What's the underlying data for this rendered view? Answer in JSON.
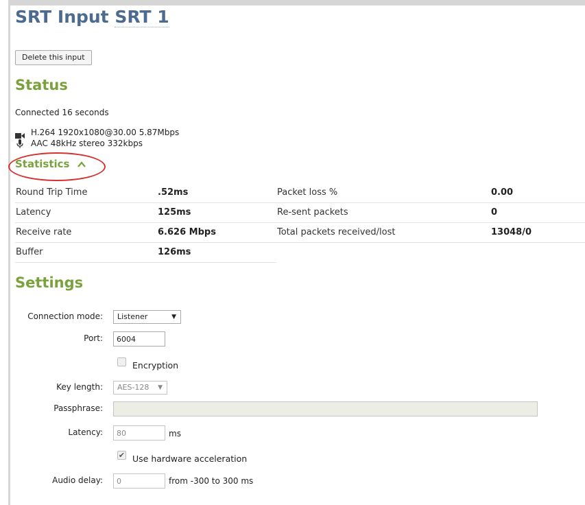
{
  "header": {
    "title_prefix": "SRT Input",
    "title_name": "SRT 1"
  },
  "actions": {
    "delete_label": "Delete this input"
  },
  "status": {
    "heading": "Status",
    "connected_text": "Connected 16 seconds",
    "video_info": "H.264 1920x1080@30.00 5.87Mbps",
    "audio_info": "AAC 48kHz stereo 332kbps",
    "icons": {
      "video": "video-camera-icon",
      "audio": "microphone-icon"
    }
  },
  "statistics": {
    "toggle_label": "Statistics",
    "toggle_icon": "^",
    "left": [
      {
        "label": "Round Trip Time",
        "value": ".52ms"
      },
      {
        "label": "Latency",
        "value": "125ms"
      },
      {
        "label": "Receive rate",
        "value": "6.626 Mbps"
      },
      {
        "label": "Buffer",
        "value": "126ms"
      }
    ],
    "right": [
      {
        "label": "Packet loss %",
        "value": "0.00"
      },
      {
        "label": "Re-sent packets",
        "value": "0"
      },
      {
        "label": "Total packets received/lost",
        "value": "13048/0"
      }
    ]
  },
  "settings": {
    "heading": "Settings",
    "connection_mode": {
      "label": "Connection mode:",
      "value": "Listener"
    },
    "port": {
      "label": "Port:",
      "value": "6004"
    },
    "encryption": {
      "label": "Encryption",
      "checked": false
    },
    "key_length": {
      "label": "Key length:",
      "value": "AES-128"
    },
    "passphrase": {
      "label": "Passphrase:",
      "value": ""
    },
    "latency": {
      "label": "Latency:",
      "value": "80",
      "unit": "ms"
    },
    "hw_accel": {
      "label": "Use hardware acceleration",
      "checked": true
    },
    "audio_delay": {
      "label": "Audio delay:",
      "value": "0",
      "hint": "from -300 to 300 ms"
    }
  },
  "colors": {
    "title": "#4d6a91",
    "heading": "#79a23d",
    "highlight": "#d63030"
  }
}
